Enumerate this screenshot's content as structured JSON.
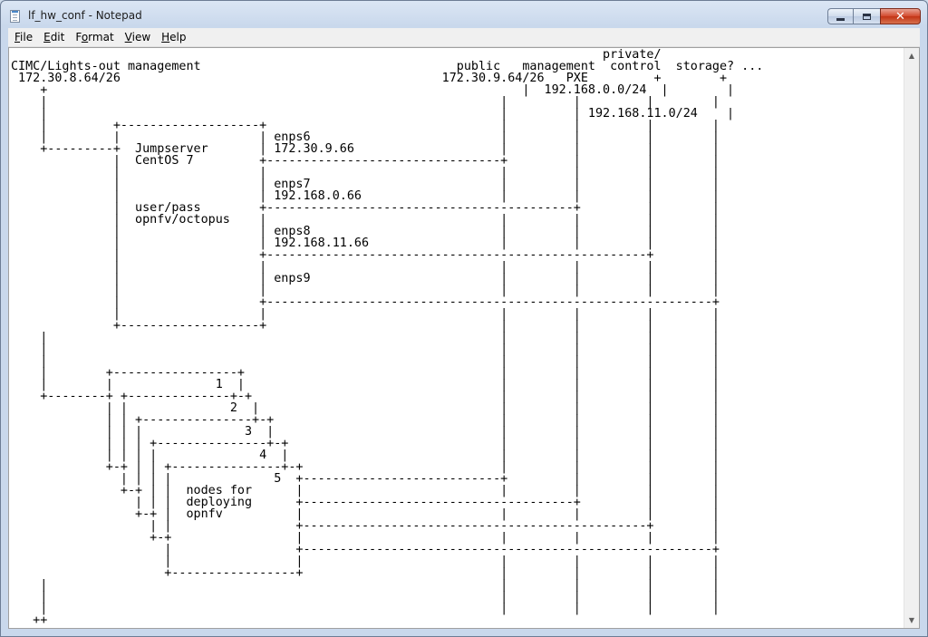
{
  "window": {
    "title": "lf_hw_conf - Notepad"
  },
  "caption": {
    "close_label": "✕"
  },
  "menu": [
    {
      "accel": "F",
      "rest": "ile"
    },
    {
      "accel": "E",
      "rest": "dit"
    },
    {
      "accel": "F",
      "rest": "ormat",
      "lead": ""
    },
    {
      "accel": "V",
      "rest": "iew"
    },
    {
      "accel": "H",
      "rest": "elp"
    }
  ],
  "menu_labels": {
    "file_accel": "F",
    "file_rest": "ile",
    "edit_accel": "E",
    "edit_rest": "dit",
    "format_accel": "o",
    "format_lead": "F",
    "format_rest": "rmat",
    "view_accel": "V",
    "view_rest": "iew",
    "help_accel": "H",
    "help_rest": "elp"
  },
  "document": {
    "text": "                                                                                 private/\nCIMC/Lights-out management                                   public   management  control  storage? ...\n 172.30.8.64/26                                            172.30.9.64/26   PXE         +        +\n    +                                                                 |  192.168.0.0/24  |        |\n    |                                                              |         |         |        |\n    |                                                              |         | 192.168.11.0/24    |\n    |         +-------------------+                                |         |         |        |\n    |         |                   | enps6                          |         |         |        |\n    +---------+  Jumpserver       | 172.30.9.66                    |         |         |        |\n              |  CentOS 7         +--------------------------------+         |         |        |\n              |                   |                                |         |         |        |\n              |                   | enps7                          |         |         |        |\n              |                   | 192.168.0.66                   |         |         |        |\n              |  user/pass        +------------------------------------------+         |        |\n              |  opnfv/octopus    |                                |         |         |        |\n              |                   | enps8                          |         |         |        |\n              |                   | 192.168.11.66                  |         |         |        |\n              |                   +----------------------------------------------------+        |\n              |                   |                                |         |         |        |\n              |                   | enps9                          |         |         |        |\n              |                   |                                |         |         |        |\n              |                   +-------------------------------------------------------------+\n              |                   |                                |         |         |        |\n              +-------------------+                                |         |         |        |\n    |                                                              |         |         |        |\n    |                                                              |         |         |        |\n    |                                                              |         |         |        |\n    |        +-----------------+                                   |         |         |        |\n    |        |              1  |                                   |         |         |        |\n    +--------+ +--------------+-+                                  |         |         |        |\n             | |              2  |                                 |         |         |        |\n             | | +---------------+-+                               |         |         |        |\n             | | |              3  |                               |         |         |        |\n             | | | +---------------+-+                             |         |         |        |\n             | | | |              4  |                             |         |         |        |\n             +-+ | | +---------------+-+                           |         |         |        |\n               | | | |              5  +---------------------------+         |         |        |\n               +-+ | |  nodes for      |                           |         |         |        |\n                 | | |  deploying      +-------------------------------------+         |        |\n                 +-+ |  opnfv          |                           |         |         |        |\n                   | |                 +-----------------------------------------------+        |\n                   +-+                 |                           |         |         |        |\n                     |                 +--------------------------------------------------------+\n                     |                 |                           |         |         |        |\n                     +-----------------+                           |         |         |        |\n    |                                                              |         |         |        |\n    |                                                              |         |         |        |\n    |                                                              |         |         |        |\n   ++"
  }
}
